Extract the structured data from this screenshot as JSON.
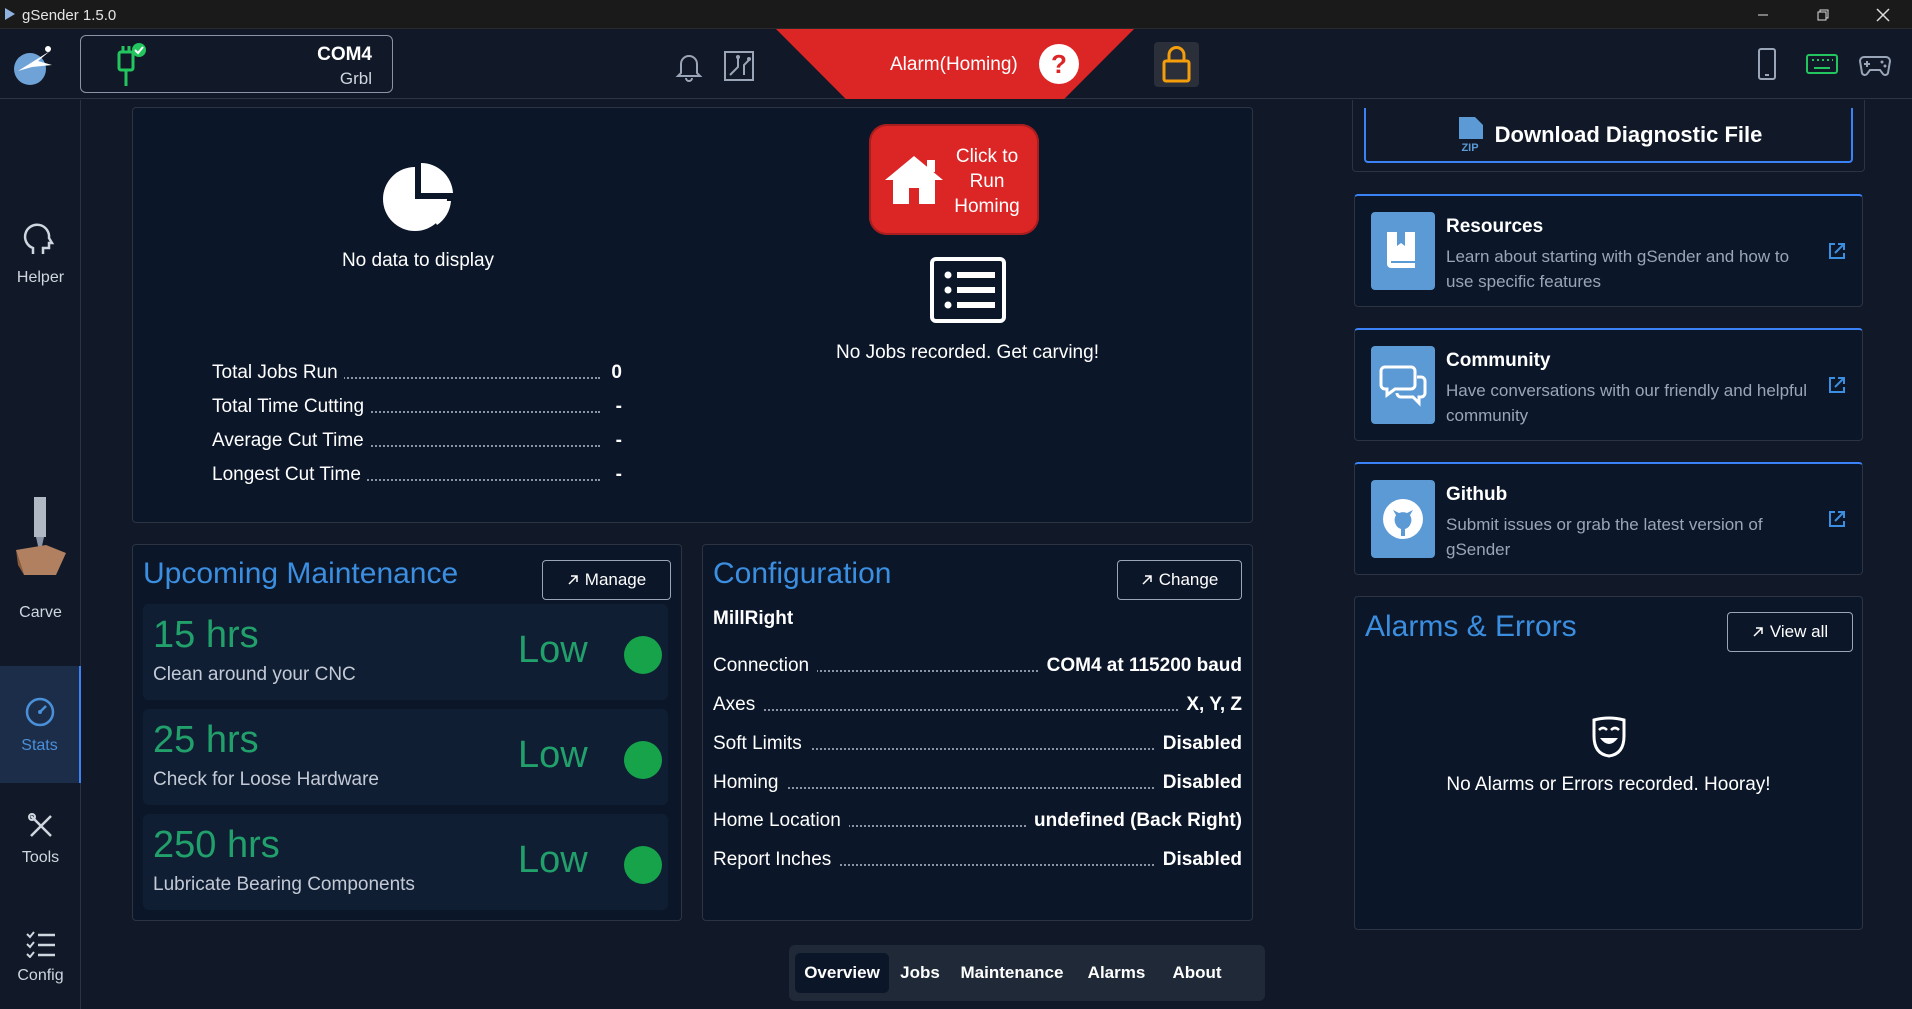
{
  "window": {
    "title": "gSender 1.5.0"
  },
  "header": {
    "connection": {
      "port": "COM4",
      "firmware": "Grbl"
    },
    "alarm_text": "Alarm(Homing)",
    "help_label": "?"
  },
  "sidebar": {
    "items": [
      {
        "label": "Helper",
        "icon": "helper-head-icon"
      },
      {
        "label": "Carve",
        "icon": "carve-tool-icon"
      },
      {
        "label": "Stats",
        "icon": "gauge-icon",
        "active": true
      },
      {
        "label": "Tools",
        "icon": "tools-icon"
      },
      {
        "label": "Config",
        "icon": "config-list-icon"
      }
    ]
  },
  "stats_panel": {
    "pie_empty_text": "No data to display",
    "homing_button": "Click to Run Homing",
    "jobs_empty_text": "No Jobs recorded. Get carving!",
    "rows": [
      {
        "label": "Total Jobs Run",
        "value": "0"
      },
      {
        "label": "Total Time Cutting",
        "value": "-"
      },
      {
        "label": "Average Cut Time",
        "value": "-"
      },
      {
        "label": "Longest Cut Time",
        "value": "-"
      }
    ]
  },
  "maintenance": {
    "title": "Upcoming Maintenance",
    "manage_label": "Manage",
    "items": [
      {
        "hours": "15 hrs",
        "description": "Clean around your CNC",
        "level": "Low"
      },
      {
        "hours": "25 hrs",
        "description": "Check for Loose Hardware",
        "level": "Low"
      },
      {
        "hours": "250 hrs",
        "description": "Lubricate Bearing Components",
        "level": "Low"
      }
    ]
  },
  "configuration": {
    "title": "Configuration",
    "change_label": "Change",
    "machine": "MillRight",
    "rows": [
      {
        "label": "Connection",
        "value": "COM4 at 115200 baud"
      },
      {
        "label": "Axes",
        "value": "X, Y, Z"
      },
      {
        "label": "Soft Limits",
        "value": "Disabled"
      },
      {
        "label": "Homing",
        "value": "Disabled"
      },
      {
        "label": "Home Location",
        "value": "undefined (Back Right)"
      },
      {
        "label": "Report Inches",
        "value": "Disabled"
      }
    ]
  },
  "right_panel": {
    "download_label": "Download Diagnostic File",
    "zip_label": "ZIP",
    "resources": [
      {
        "title": "Resources",
        "description": "Learn about starting with gSender and how to use specific features"
      },
      {
        "title": "Community",
        "description": "Have conversations with our friendly and helpful community"
      },
      {
        "title": "Github",
        "description": "Submit issues or grab the latest version of gSender"
      }
    ],
    "alarms": {
      "title": "Alarms & Errors",
      "view_all_label": "View all",
      "empty_text": "No Alarms or Errors recorded. Hooray!"
    }
  },
  "tabs": [
    {
      "label": "Overview",
      "active": true
    },
    {
      "label": "Jobs"
    },
    {
      "label": "Maintenance"
    },
    {
      "label": "Alarms"
    },
    {
      "label": "About"
    }
  ],
  "colors": {
    "accent": "#3b8ee0",
    "alarm": "#dc2626",
    "ok": "#16a34a"
  }
}
